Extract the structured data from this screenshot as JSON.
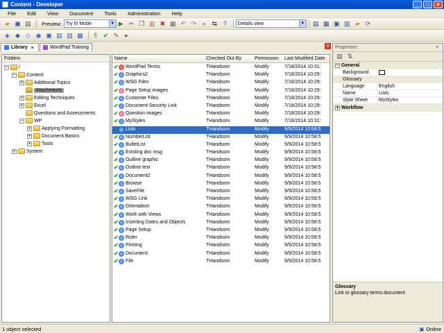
{
  "window": {
    "title": "Content - Developer"
  },
  "menu": [
    "File",
    "Edit",
    "View",
    "Document",
    "Tools",
    "Administration",
    "Help"
  ],
  "toolbar": {
    "preview_label": "Preview:",
    "preview_value": "Try It! Mode",
    "view_value": "Details view"
  },
  "tabs": [
    {
      "label": "Library"
    },
    {
      "label": "WordPad Training"
    }
  ],
  "folders": {
    "header": "Folders",
    "nodes": [
      "/",
      "Content",
      "Additional Topics",
      "Attachments",
      "Editing Techniques",
      "Excel",
      "Questions and Assessments",
      "WP",
      "Applying Formatting",
      "Document Basics",
      "Tools",
      "System"
    ]
  },
  "list": {
    "columns": [
      "Name",
      "Checked Out By",
      "Permission",
      "Last Modified Date"
    ],
    "rows": [
      {
        "name": "WordPad Terms",
        "by": "THandsom",
        "perm": "Modify",
        "date": "7/18/2014 10:31:"
      },
      {
        "name": "Graphics2",
        "by": "THandsom",
        "perm": "Modify",
        "date": "7/18/2014 10:29:"
      },
      {
        "name": "WSG Files",
        "by": "THandsom",
        "perm": "Modify",
        "date": "7/18/2014 10:29:"
      },
      {
        "name": "Page Setup images",
        "by": "THandsom",
        "perm": "Modify",
        "date": "7/18/2014 10:29:"
      },
      {
        "name": "Customer Files",
        "by": "THandsom",
        "perm": "Modify",
        "date": "7/18/2014 10:29:"
      },
      {
        "name": "Document Security Link",
        "by": "THandsom",
        "perm": "Modify",
        "date": "7/18/2014 10:29:"
      },
      {
        "name": "Question images",
        "by": "THandsom",
        "perm": "Modify",
        "date": "7/18/2014 10:29:"
      },
      {
        "name": "MyStyles",
        "by": "THandsom",
        "perm": "Modify",
        "date": "7/18/2014 10:31:"
      },
      {
        "name": "Lists",
        "by": "THandsom",
        "perm": "Modify",
        "date": "9/9/2014 10:58:5"
      },
      {
        "name": "NumberList",
        "by": "THandsom",
        "perm": "Modify",
        "date": "9/9/2014 10:58:5"
      },
      {
        "name": "BulletList",
        "by": "THandsom",
        "perm": "Modify",
        "date": "9/9/2014 10:58:5"
      },
      {
        "name": "Existing doc msg",
        "by": "THandsom",
        "perm": "Modify",
        "date": "9/9/2014 10:58:5"
      },
      {
        "name": "Outline graphic",
        "by": "THandsom",
        "perm": "Modify",
        "date": "9/9/2014 10:58:5"
      },
      {
        "name": "Outline text",
        "by": "THandsom",
        "perm": "Modify",
        "date": "9/9/2014 10:58:5"
      },
      {
        "name": "Document2",
        "by": "THandsom",
        "perm": "Modify",
        "date": "9/9/2014 10:58:5"
      },
      {
        "name": "Browse",
        "by": "THandsom",
        "perm": "Modify",
        "date": "9/9/2014 10:58:5"
      },
      {
        "name": "SaveFile",
        "by": "THandsom",
        "perm": "Modify",
        "date": "9/9/2014 10:58:5"
      },
      {
        "name": "WSG Link",
        "by": "THandsom",
        "perm": "Modify",
        "date": "9/9/2014 10:58:5"
      },
      {
        "name": "Orientation",
        "by": "THandsom",
        "perm": "Modify",
        "date": "9/9/2014 10:58:5"
      },
      {
        "name": "Work with Views",
        "by": "THandsom",
        "perm": "Modify",
        "date": "9/9/2014 10:58:5"
      },
      {
        "name": "Inserting Dates and Objects",
        "by": "THandsom",
        "perm": "Modify",
        "date": "9/9/2014 10:58:5"
      },
      {
        "name": "Page Setup",
        "by": "THandsom",
        "perm": "Modify",
        "date": "9/9/2014 10:58:5"
      },
      {
        "name": "Ruler",
        "by": "THandsom",
        "perm": "Modify",
        "date": "9/9/2014 10:58:5"
      },
      {
        "name": "Printing",
        "by": "THandsom",
        "perm": "Modify",
        "date": "9/9/2014 10:58:5"
      },
      {
        "name": "Document",
        "by": "THandsom",
        "perm": "Modify",
        "date": "9/9/2014 10:58:5"
      },
      {
        "name": "File",
        "by": "THandsom",
        "perm": "Modify",
        "date": "9/9/2014 10:58:5"
      }
    ]
  },
  "properties": {
    "title": "Properties",
    "general_label": "General",
    "workflow_label": "Workflow",
    "rows": [
      {
        "key": "Background color",
        "value": ""
      },
      {
        "key": "Glossary",
        "value": ""
      },
      {
        "key": "Language",
        "value": "English"
      },
      {
        "key": "Name",
        "value": "Lists"
      },
      {
        "key": "Style Sheet",
        "value": "MyStyles"
      }
    ],
    "help_title": "Glossary",
    "help_text": "Link to glossary terms document"
  },
  "status": {
    "left": "1 object selected",
    "right": "Online"
  }
}
